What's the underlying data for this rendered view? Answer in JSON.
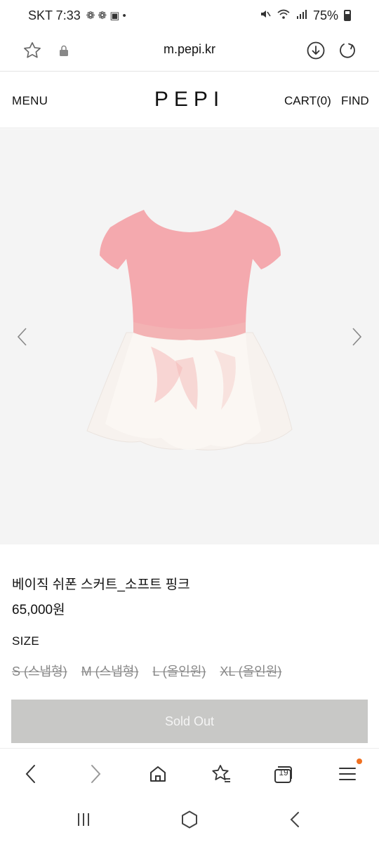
{
  "status_bar": {
    "carrier_time": "SKT 7:33",
    "notif_icons": "❁ ❁ ▣ •",
    "battery_pct": "75%",
    "icons": [
      "mute-icon",
      "wifi-icon",
      "signal-icon",
      "battery-icon"
    ]
  },
  "browser": {
    "url": "m.pepi.kr"
  },
  "header": {
    "menu_label": "MENU",
    "logo": "PEPI",
    "cart_label": "CART(0)",
    "find_label": "FIND"
  },
  "product": {
    "name": "베이직 쉬폰 스커트_소프트 핑크",
    "price": "65,000원",
    "size_label": "SIZE",
    "sizes": [
      "S (스냅형)",
      "M (스냅형)",
      "L (올인원)",
      "XL (올인원)"
    ],
    "sold_out_label": "Sold Out",
    "colors": {
      "bodice": "#f4a9ae",
      "skirt": "#fbf7f3",
      "sold_out_bg": "#c8c8c6"
    }
  },
  "browser_nav": {
    "tab_count": "19"
  }
}
